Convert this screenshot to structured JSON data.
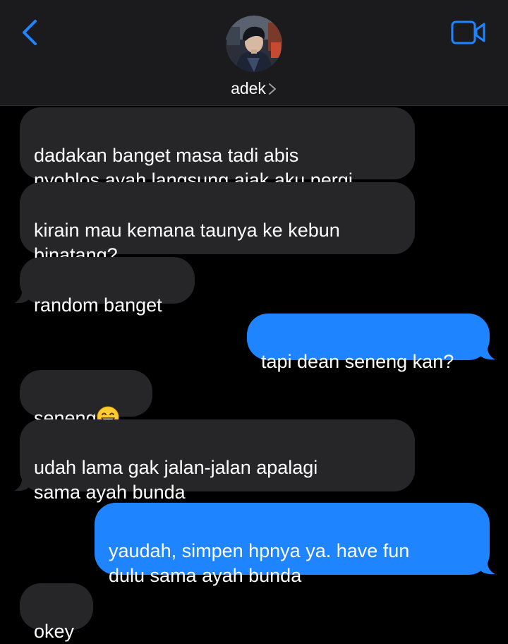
{
  "header": {
    "contact_name": "adek",
    "back_icon": "chevron-left-icon",
    "video_icon": "video-camera-icon",
    "avatar": "contact-avatar-photo",
    "accent_color": "#1f84ff"
  },
  "messages": [
    {
      "from": "contact",
      "text": "dadakan banget masa tadi abis\nnyoblos ayah langsung ajak aku pergi"
    },
    {
      "from": "contact",
      "text": "kirain mau kemana taunya ke kebun\nbinatang?"
    },
    {
      "from": "contact",
      "text": "random banget"
    },
    {
      "from": "me",
      "text": "tapi dean seneng kan?"
    },
    {
      "from": "contact",
      "text": "seneng",
      "emoji": "grinning-face-emoji"
    },
    {
      "from": "contact",
      "text": "udah lama gak jalan-jalan apalagi\nsama ayah bunda"
    },
    {
      "from": "me",
      "text": "yaudah, simpen hpnya ya. have fun\ndulu sama ayah bunda"
    },
    {
      "from": "contact",
      "text": "okey"
    }
  ]
}
